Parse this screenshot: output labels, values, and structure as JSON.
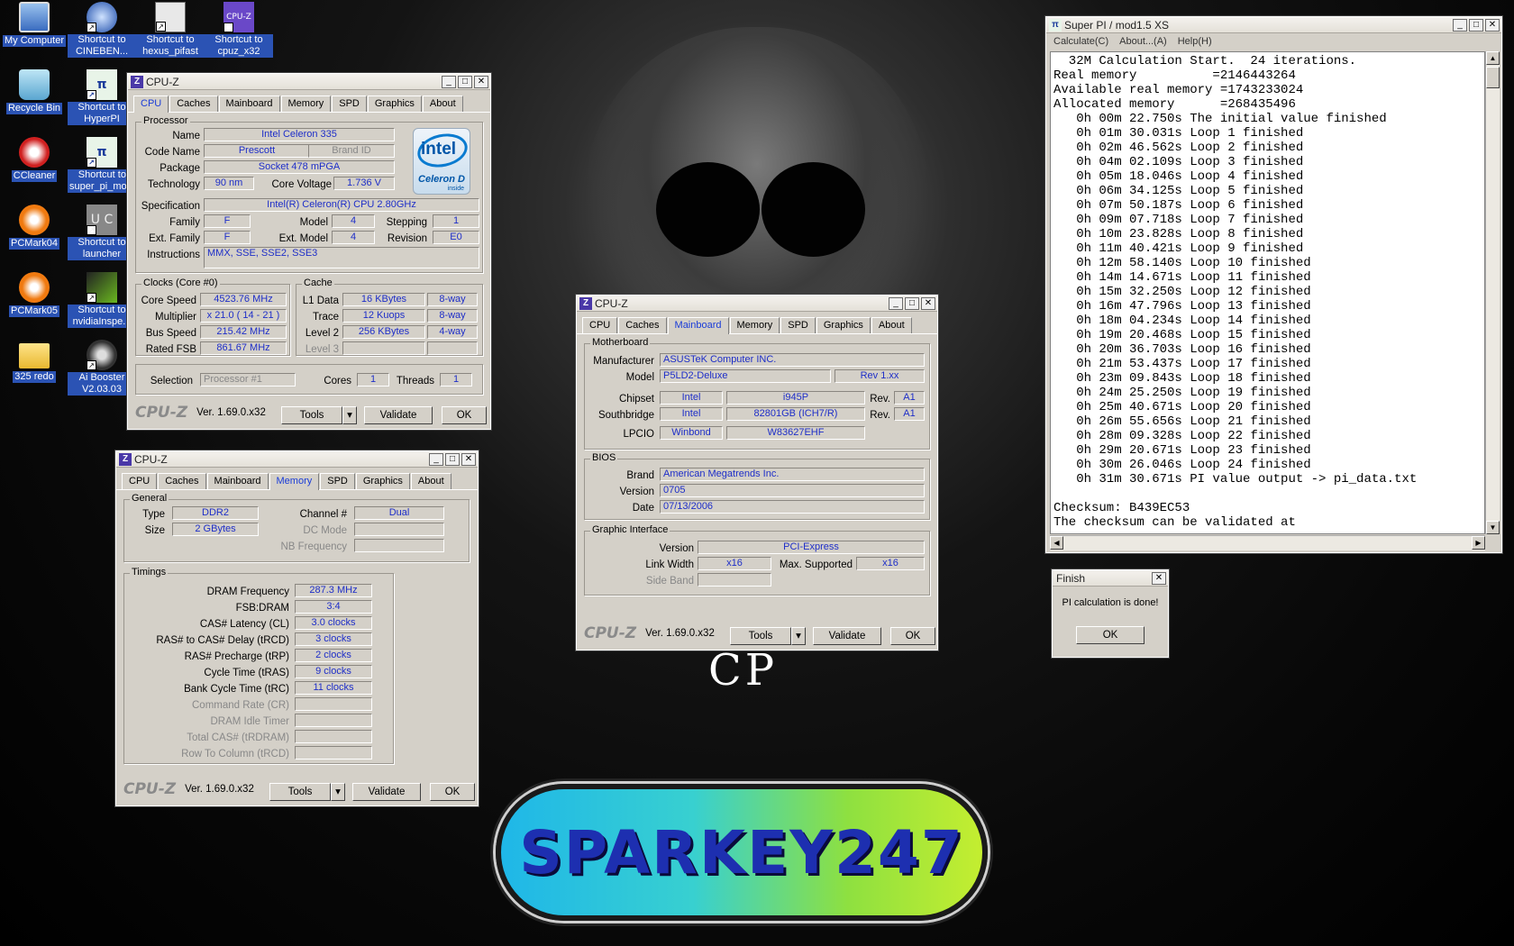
{
  "desktop": {
    "icons": [
      {
        "label": "My Computer"
      },
      {
        "label": "Shortcut to CINEBEN..."
      },
      {
        "label": "Shortcut to hexus_pifast"
      },
      {
        "label": "Shortcut to cpuz_x32"
      },
      {
        "label": "Recycle Bin"
      },
      {
        "label": "Shortcut to HyperPI"
      },
      {
        "label": "CCleaner"
      },
      {
        "label": "Shortcut to super_pi_mo..."
      },
      {
        "label": "PCMark04"
      },
      {
        "label": "Shortcut to launcher"
      },
      {
        "label": "PCMark05"
      },
      {
        "label": "Shortcut to nvidiaInspe..."
      },
      {
        "label": "325 redo"
      },
      {
        "label": "Ai Booster V2.03.03"
      }
    ],
    "banner_text": "SPARKEY247",
    "wallpaper_text": "CP"
  },
  "cpuz": {
    "title": "CPU-Z",
    "tabs": [
      "CPU",
      "Caches",
      "Mainboard",
      "Memory",
      "SPD",
      "Graphics",
      "About"
    ],
    "logo": "CPU-Z",
    "version": "Ver. 1.69.0.x32",
    "tools": "Tools",
    "validate": "Validate",
    "ok": "OK"
  },
  "cpu": {
    "processor_group": "Processor",
    "name_lbl": "Name",
    "name": "Intel Celeron 335",
    "codename_lbl": "Code Name",
    "codename": "Prescott",
    "brandid_lbl": "Brand ID",
    "package_lbl": "Package",
    "package": "Socket 478 mPGA",
    "tech_lbl": "Technology",
    "tech": "90 nm",
    "corev_lbl": "Core Voltage",
    "corev": "1.736 V",
    "spec_lbl": "Specification",
    "spec": "Intel(R) Celeron(R) CPU 2.80GHz",
    "family_lbl": "Family",
    "family": "F",
    "model_lbl": "Model",
    "model": "4",
    "stepping_lbl": "Stepping",
    "stepping": "1",
    "extfam_lbl": "Ext. Family",
    "extfam": "F",
    "extmodel_lbl": "Ext. Model",
    "extmodel": "4",
    "revision_lbl": "Revision",
    "revision": "E0",
    "instr_lbl": "Instructions",
    "instr": "MMX, SSE, SSE2, SSE3",
    "clocks_group": "Clocks (Core #0)",
    "corespeed_lbl": "Core Speed",
    "corespeed": "4523.76 MHz",
    "mult_lbl": "Multiplier",
    "mult": "x 21.0 ( 14 - 21 )",
    "bus_lbl": "Bus Speed",
    "bus": "215.42 MHz",
    "fsb_lbl": "Rated FSB",
    "fsb": "861.67 MHz",
    "cache_group": "Cache",
    "l1_lbl": "L1 Data",
    "l1": "16 KBytes",
    "l1w": "8-way",
    "trace_lbl": "Trace",
    "trace": "12 Kuops",
    "tracew": "8-way",
    "l2_lbl": "Level 2",
    "l2": "256 KBytes",
    "l2w": "4-way",
    "l3_lbl": "Level 3",
    "sel_lbl": "Selection",
    "sel": "Processor #1",
    "cores_lbl": "Cores",
    "cores": "1",
    "threads_lbl": "Threads",
    "threads": "1",
    "intel_logo": "intel",
    "intel_sub": "Celeron D",
    "intel_inside": "inside"
  },
  "mem": {
    "general": "General",
    "type_lbl": "Type",
    "type": "DDR2",
    "chan_lbl": "Channel #",
    "chan": "Dual",
    "size_lbl": "Size",
    "size": "2 GBytes",
    "dc_lbl": "DC Mode",
    "nb_lbl": "NB Frequency",
    "timings": "Timings",
    "rows": [
      {
        "label": "DRAM Frequency",
        "value": "287.3 MHz"
      },
      {
        "label": "FSB:DRAM",
        "value": "3:4"
      },
      {
        "label": "CAS# Latency (CL)",
        "value": "3.0 clocks"
      },
      {
        "label": "RAS# to CAS# Delay (tRCD)",
        "value": "3 clocks"
      },
      {
        "label": "RAS# Precharge (tRP)",
        "value": "2 clocks"
      },
      {
        "label": "Cycle Time (tRAS)",
        "value": "9 clocks"
      },
      {
        "label": "Bank Cycle Time (tRC)",
        "value": "11 clocks"
      },
      {
        "label": "Command Rate (CR)",
        "value": ""
      },
      {
        "label": "DRAM Idle Timer",
        "value": ""
      },
      {
        "label": "Total CAS# (tRDRAM)",
        "value": ""
      },
      {
        "label": "Row To Column (tRCD)",
        "value": ""
      }
    ]
  },
  "mb": {
    "mb_group": "Motherboard",
    "manu_lbl": "Manufacturer",
    "manu": "ASUSTeK Computer INC.",
    "model_lbl": "Model",
    "model": "P5LD2-Deluxe",
    "rev": "Rev 1.xx",
    "chipset_lbl": "Chipset",
    "chipset_v": "Intel",
    "chipset_m": "i945P",
    "rev_lbl": "Rev.",
    "chipset_r": "A1",
    "south_lbl": "Southbridge",
    "south_v": "Intel",
    "south_m": "82801GB (ICH7/R)",
    "south_r": "A1",
    "lpcio_lbl": "LPCIO",
    "lpcio_v": "Winbond",
    "lpcio_m": "W83627EHF",
    "bios_group": "BIOS",
    "brand_lbl": "Brand",
    "brand": "American Megatrends Inc.",
    "ver_lbl": "Version",
    "ver": "0705",
    "date_lbl": "Date",
    "date": "07/13/2006",
    "gi_group": "Graphic Interface",
    "giver_lbl": "Version",
    "giver": "PCI-Express",
    "lw_lbl": "Link Width",
    "lw": "x16",
    "ms_lbl": "Max. Supported",
    "ms": "x16",
    "sb_lbl": "Side Band"
  },
  "superpi": {
    "title": "Super PI / mod1.5 XS",
    "menu": [
      "Calculate(C)",
      "About...(A)",
      "Help(H)"
    ],
    "lines": [
      "  32M Calculation Start.  24 iterations.",
      "Real memory          =2146443264",
      "Available real memory =1743233024",
      "Allocated memory      =268435496",
      "   0h 00m 22.750s The initial value finished",
      "   0h 01m 30.031s Loop 1 finished",
      "   0h 02m 46.562s Loop 2 finished",
      "   0h 04m 02.109s Loop 3 finished",
      "   0h 05m 18.046s Loop 4 finished",
      "   0h 06m 34.125s Loop 5 finished",
      "   0h 07m 50.187s Loop 6 finished",
      "   0h 09m 07.718s Loop 7 finished",
      "   0h 10m 23.828s Loop 8 finished",
      "   0h 11m 40.421s Loop 9 finished",
      "   0h 12m 58.140s Loop 10 finished",
      "   0h 14m 14.671s Loop 11 finished",
      "   0h 15m 32.250s Loop 12 finished",
      "   0h 16m 47.796s Loop 13 finished",
      "   0h 18m 04.234s Loop 14 finished",
      "   0h 19m 20.468s Loop 15 finished",
      "   0h 20m 36.703s Loop 16 finished",
      "   0h 21m 53.437s Loop 17 finished",
      "   0h 23m 09.843s Loop 18 finished",
      "   0h 24m 25.250s Loop 19 finished",
      "   0h 25m 40.671s Loop 20 finished",
      "   0h 26m 55.656s Loop 21 finished",
      "   0h 28m 09.328s Loop 22 finished",
      "   0h 29m 20.671s Loop 23 finished",
      "   0h 30m 26.046s Loop 24 finished",
      "   0h 31m 30.671s PI value output -> pi_data.txt",
      "",
      "Checksum: B439EC53",
      "The checksum can be validated at"
    ]
  },
  "finish": {
    "title": "Finish",
    "message": "PI calculation is done!",
    "ok": "OK"
  }
}
